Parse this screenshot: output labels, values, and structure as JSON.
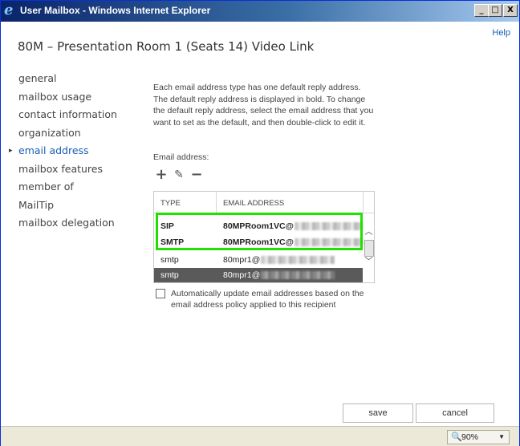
{
  "window": {
    "title": "User Mailbox - Windows Internet Explorer",
    "app_icon": "internet-explorer-icon",
    "controls": {
      "minimize": "_",
      "maximize": "□",
      "close": "X"
    }
  },
  "help": "Help",
  "page_title": "80M – Presentation Room 1 (Seats 14) Video Link",
  "sidebar": {
    "items": [
      {
        "label": "general",
        "active": false
      },
      {
        "label": "mailbox usage",
        "active": false
      },
      {
        "label": "contact information",
        "active": false
      },
      {
        "label": "organization",
        "active": false
      },
      {
        "label": "email address",
        "active": true
      },
      {
        "label": "mailbox features",
        "active": false
      },
      {
        "label": "member of",
        "active": false
      },
      {
        "label": "MailTip",
        "active": false
      },
      {
        "label": "mailbox delegation",
        "active": false
      }
    ],
    "active_marker": "▸"
  },
  "description": "Each email address type has one default reply address. The default reply address is displayed in bold. To change the default reply address, select the email address that you want to set as the default, and then double-click to edit it.",
  "email_label": "Email address:",
  "toolbar": {
    "add_icon": "+",
    "edit_icon": "✎",
    "remove_icon": "−"
  },
  "table": {
    "headers": {
      "type": "TYPE",
      "email": "EMAIL ADDRESS"
    },
    "rows": [
      {
        "type": "SIP",
        "email_prefix": "80MPRoom1VC@",
        "bold": true,
        "selected": false
      },
      {
        "type": "SMTP",
        "email_prefix": "80MPRoom1VC@",
        "bold": true,
        "selected": false
      },
      {
        "type": "smtp",
        "email_prefix": "80mpr1@",
        "bold": false,
        "selected": false
      },
      {
        "type": "smtp",
        "email_prefix": "80mpr1@",
        "bold": false,
        "selected": true
      }
    ],
    "scroll": {
      "up": "︿",
      "down": "﹀"
    }
  },
  "auto_update": {
    "checked": false,
    "label": "Automatically update email addresses based on the email address policy applied to this recipient"
  },
  "buttons": {
    "save": "save",
    "cancel": "cancel"
  },
  "statusbar": {
    "zoom": "90%",
    "zoom_icon": "🔍",
    "zoom_arrow": "▼"
  },
  "colors": {
    "highlight": "#22e000",
    "link": "#1a5fb4",
    "selected_row": "#5a5a5a"
  }
}
